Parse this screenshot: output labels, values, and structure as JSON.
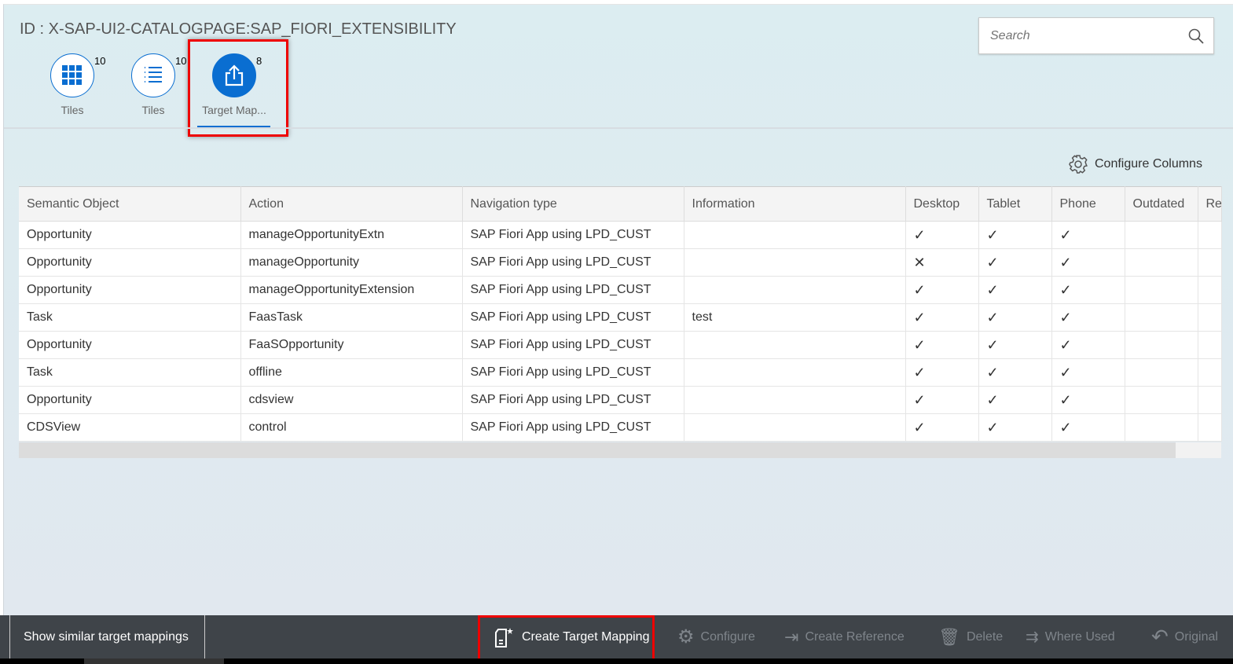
{
  "header": {
    "title": "ID : X-SAP-UI2-CATALOGPAGE:SAP_FIORI_EXTENSIBILITY",
    "search_placeholder": "Search"
  },
  "tabs": [
    {
      "label": "Tiles",
      "count": "10",
      "icon": "grid-icon"
    },
    {
      "label": "Tiles",
      "count": "10",
      "icon": "list-icon"
    },
    {
      "label": "Target Map...",
      "count": "8",
      "icon": "share-icon",
      "selected": true
    }
  ],
  "configure_columns": "Configure Columns",
  "table": {
    "columns": [
      "Semantic Object",
      "Action",
      "Navigation type",
      "Information",
      "Desktop",
      "Tablet",
      "Phone",
      "Outdated",
      "Re"
    ],
    "rows": [
      [
        "Opportunity",
        "manageOpportunityExtn",
        "SAP Fiori App using LPD_CUST",
        "",
        "✓",
        "✓",
        "✓",
        "",
        ""
      ],
      [
        "Opportunity",
        "manageOpportunity",
        "SAP Fiori App using LPD_CUST",
        "",
        "✕",
        "✓",
        "✓",
        "",
        ""
      ],
      [
        "Opportunity",
        "manageOpportunityExtension",
        "SAP Fiori App using LPD_CUST",
        "",
        "✓",
        "✓",
        "✓",
        "",
        ""
      ],
      [
        "Task",
        "FaasTask",
        "SAP Fiori App using LPD_CUST",
        "test",
        "✓",
        "✓",
        "✓",
        "",
        ""
      ],
      [
        "Opportunity",
        "FaaSOpportunity",
        "SAP Fiori App using LPD_CUST",
        "",
        "✓",
        "✓",
        "✓",
        "",
        ""
      ],
      [
        "Task",
        "offline",
        "SAP Fiori App using LPD_CUST",
        "",
        "✓",
        "✓",
        "✓",
        "",
        ""
      ],
      [
        "Opportunity",
        "cdsview",
        "SAP Fiori App using LPD_CUST",
        "",
        "✓",
        "✓",
        "✓",
        "",
        ""
      ],
      [
        "CDSView",
        "control",
        "SAP Fiori App using LPD_CUST",
        "",
        "✓",
        "✓",
        "✓",
        "",
        ""
      ]
    ]
  },
  "footer": {
    "show_similar": "Show similar target mappings",
    "create": "Create Target Mapping",
    "configure": "Configure",
    "create_reference": "Create Reference",
    "delete": "Delete",
    "where_used": "Where Used",
    "original": "Original"
  }
}
